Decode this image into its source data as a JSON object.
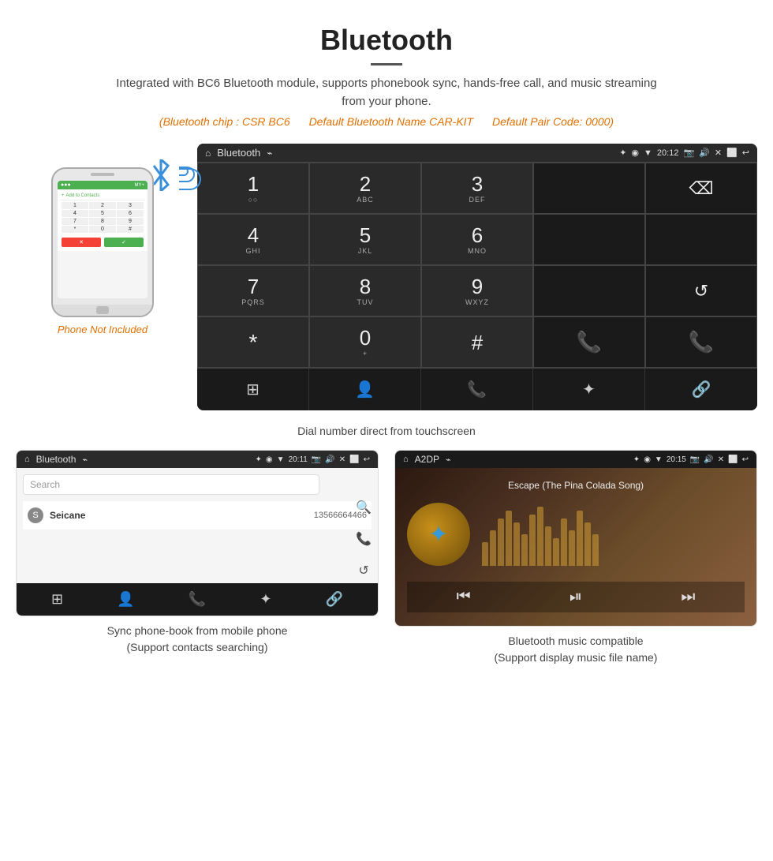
{
  "header": {
    "title": "Bluetooth",
    "description": "Integrated with BC6 Bluetooth module, supports phonebook sync, hands-free call, and music streaming from your phone.",
    "specs": {
      "chip": "(Bluetooth chip : CSR BC6",
      "name": "Default Bluetooth Name CAR-KIT",
      "code": "Default Pair Code: 0000)"
    }
  },
  "phone_not_included": "Phone Not Included",
  "dialer": {
    "title": "Bluetooth",
    "status_time": "20:12",
    "keys": [
      {
        "num": "1",
        "letters": "○○"
      },
      {
        "num": "2",
        "letters": "ABC"
      },
      {
        "num": "3",
        "letters": "DEF"
      },
      {
        "num": "",
        "letters": ""
      },
      {
        "num": "⌫",
        "letters": ""
      }
    ],
    "keys_row2": [
      {
        "num": "4",
        "letters": "GHI"
      },
      {
        "num": "5",
        "letters": "JKL"
      },
      {
        "num": "6",
        "letters": "MNO"
      },
      {
        "num": "",
        "letters": ""
      },
      {
        "num": "",
        "letters": ""
      }
    ],
    "keys_row3": [
      {
        "num": "7",
        "letters": "PQRS"
      },
      {
        "num": "8",
        "letters": "TUV"
      },
      {
        "num": "9",
        "letters": "WXYZ"
      },
      {
        "num": "",
        "letters": ""
      },
      {
        "num": "↺",
        "letters": ""
      }
    ],
    "keys_row4": [
      {
        "num": "*",
        "letters": ""
      },
      {
        "num": "0",
        "letters": "+"
      },
      {
        "num": "#",
        "letters": ""
      },
      {
        "num": "📞",
        "letters": "green"
      },
      {
        "num": "📞",
        "letters": "red"
      }
    ],
    "caption": "Dial number direct from touchscreen"
  },
  "phonebook": {
    "title": "Bluetooth",
    "status_time": "20:11",
    "search_placeholder": "Search",
    "contact_name": "Seicane",
    "contact_number": "13566664466",
    "contact_letter": "S",
    "caption_line1": "Sync phone-book from mobile phone",
    "caption_line2": "(Support contacts searching)"
  },
  "music": {
    "title": "A2DP",
    "status_time": "20:15",
    "song_title": "Escape (The Pina Colada Song)",
    "caption_line1": "Bluetooth music compatible",
    "caption_line2": "(Support display music file name)"
  },
  "eq_bars": [
    30,
    45,
    60,
    70,
    55,
    40,
    65,
    75,
    50,
    35,
    60,
    45,
    70,
    55,
    40
  ]
}
